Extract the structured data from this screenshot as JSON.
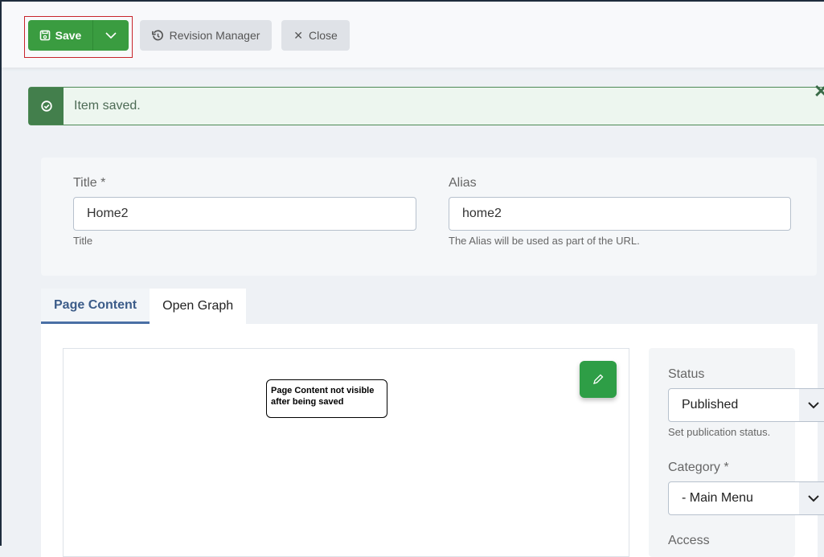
{
  "toolbar": {
    "save_label": "Save",
    "revision_label": "Revision Manager",
    "close_label": "Close"
  },
  "alert": {
    "message": "Item saved."
  },
  "form": {
    "title_label": "Title *",
    "title_value": "Home2",
    "title_help": "Title",
    "alias_label": "Alias",
    "alias_value": "home2",
    "alias_help": "The Alias will be used as part of the URL."
  },
  "tabs": [
    {
      "label": "Page Content"
    },
    {
      "label": "Open Graph"
    }
  ],
  "editor": {
    "annotation": "Page Content not visible after being saved"
  },
  "sidebar": {
    "status_label": "Status",
    "status_value": "Published",
    "status_help": "Set publication status.",
    "category_label": "Category *",
    "category_value": "- Main Menu",
    "access_label": "Access"
  },
  "colors": {
    "save": "#3a9c40",
    "alert": "#437f4c",
    "tab_active": "#4a6fa5"
  }
}
